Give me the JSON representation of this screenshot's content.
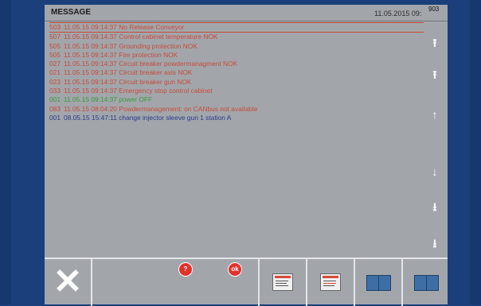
{
  "header": {
    "title": "MESSAGE",
    "datetime": "11.05.2015 09:",
    "code": "903"
  },
  "messages": [
    {
      "num": "503",
      "time": "11.05.15 09:14:37",
      "text": "No Release Conveyor",
      "color": "#c84a3a",
      "selected": true
    },
    {
      "num": "507",
      "time": "11.05.15 09:14:37",
      "text": "Control cabinet temperature NOK",
      "color": "#c84a3a"
    },
    {
      "num": "505",
      "time": "11.05.15 09:14:37",
      "text": "Grounding protection NOK",
      "color": "#c84a3a"
    },
    {
      "num": "505",
      "time": "11.05.15 09:14:37",
      "text": "Fire protection NOK",
      "color": "#c84a3a"
    },
    {
      "num": "027",
      "time": "11.05.15 09:14:37",
      "text": "Circuit breaker powdermanagment NOK",
      "color": "#c84a3a"
    },
    {
      "num": "021",
      "time": "11.05.15 09:14:37",
      "text": "Circuit breaker axis NOK",
      "color": "#c84a3a"
    },
    {
      "num": "023",
      "time": "11.05.15 09:14:37",
      "text": "Circuit breaker gun NOK",
      "color": "#c84a3a"
    },
    {
      "num": "033",
      "time": "11.05.15 09:14:37",
      "text": "Emergency stop control cabinet",
      "color": "#c84a3a"
    },
    {
      "num": "001",
      "time": "11.05.15 09:14:37",
      "text": "power OFF",
      "color": "#3a9a3a"
    },
    {
      "num": "083",
      "time": "11.05.15 08:04:20",
      "text": "Powdermanagement: on CANbus not available",
      "color": "#c84a3a"
    },
    {
      "num": "001",
      "time": "08.05.15 15:47:11",
      "text": "change injector sleeve gun 1 station A",
      "color": "#2a3a8a"
    }
  ],
  "scroll": {
    "top_icon": "scroll-to-top-icon",
    "page_up_icon": "page-up-icon",
    "up_icon": "arrow-up-icon",
    "down_icon": "arrow-down-icon",
    "page_down_icon": "page-down-icon",
    "bottom_icon": "scroll-to-bottom-icon"
  },
  "footer": {
    "close_glyph": "✕",
    "help_label": "?",
    "ok_label": "ok"
  },
  "colors": {
    "background": "#1a3f7a",
    "panel": "#a2a6ab",
    "error": "#c84a3a",
    "ok": "#3a9a3a",
    "info": "#2a3a8a"
  }
}
